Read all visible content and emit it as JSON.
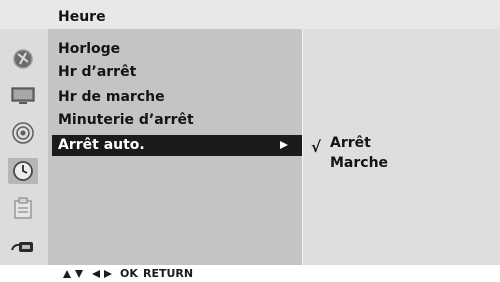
{
  "header": {
    "title": "Heure"
  },
  "menu": {
    "items": [
      {
        "label": "Horloge"
      },
      {
        "label": "Hr d’arrêt"
      },
      {
        "label": "Hr de marche"
      },
      {
        "label": "Minuterie d’arrêt"
      },
      {
        "label": "Arrêt auto."
      }
    ],
    "selected_index": 4
  },
  "submenu": {
    "check_mark": "√",
    "options": [
      {
        "label": "Arrêt"
      },
      {
        "label": "Marche"
      }
    ],
    "checked_index": 0
  },
  "footer": {
    "ok_label": "OK",
    "return_label": "RETURN"
  },
  "colors": {
    "selected_bg": "#1b1b1b",
    "panel_left": "#c4c4c4",
    "panel_right": "#dedede"
  },
  "icons": [
    "picture-icon",
    "screen-icon",
    "audio-icon",
    "clock-icon",
    "lock-icon",
    "input-icon"
  ],
  "active_icon": "clock-icon"
}
